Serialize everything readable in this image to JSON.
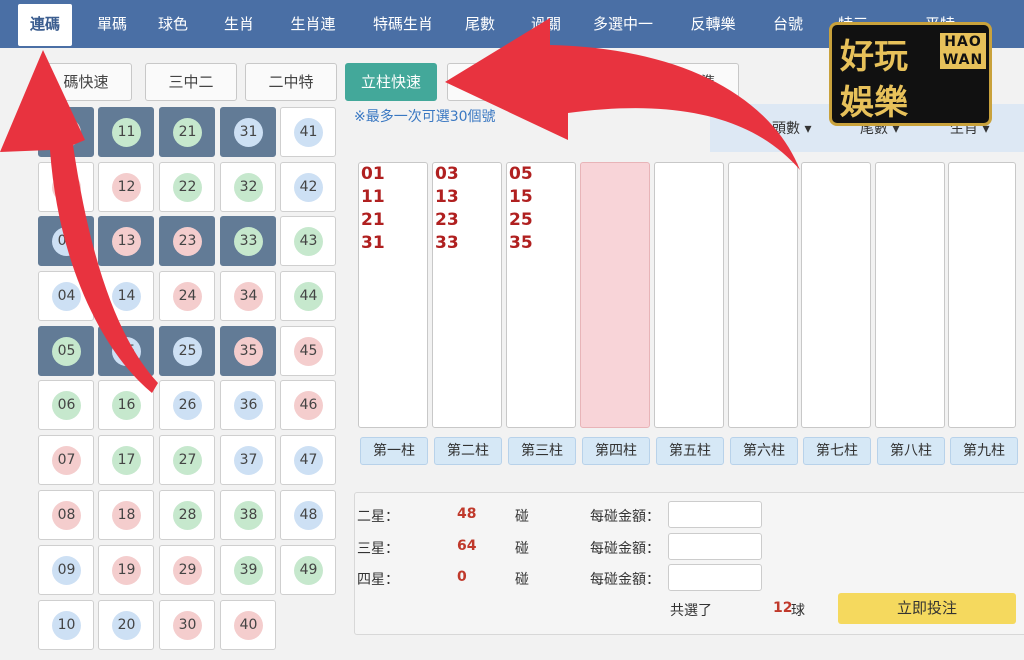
{
  "nav": {
    "items": [
      "連碼",
      "單碼",
      "球色",
      "生肖",
      "生肖連",
      "特碼生肖",
      "尾數",
      "過關",
      "多選中一",
      "反轉樂",
      "台號",
      "特三",
      "平特"
    ],
    "active_index": 0
  },
  "modes": {
    "items": [
      "碼快速",
      "三中二",
      "二中特",
      "立柱快速",
      "",
      "碰標準"
    ],
    "active_index": 3
  },
  "grid": {
    "rows": [
      [
        {
          "n": "01",
          "c": "red",
          "sel": true
        },
        {
          "n": "11",
          "c": "green",
          "sel": true
        },
        {
          "n": "21",
          "c": "green",
          "sel": true
        },
        {
          "n": "31",
          "c": "blue",
          "sel": true
        },
        {
          "n": "41",
          "c": "blue",
          "sel": false
        }
      ],
      [
        {
          "n": "02",
          "c": "red",
          "sel": false
        },
        {
          "n": "12",
          "c": "red",
          "sel": false
        },
        {
          "n": "22",
          "c": "green",
          "sel": false
        },
        {
          "n": "32",
          "c": "green",
          "sel": false
        },
        {
          "n": "42",
          "c": "blue",
          "sel": false
        }
      ],
      [
        {
          "n": "03",
          "c": "blue",
          "sel": true
        },
        {
          "n": "13",
          "c": "red",
          "sel": true
        },
        {
          "n": "23",
          "c": "red",
          "sel": true
        },
        {
          "n": "33",
          "c": "green",
          "sel": true
        },
        {
          "n": "43",
          "c": "green",
          "sel": false
        }
      ],
      [
        {
          "n": "04",
          "c": "blue",
          "sel": false
        },
        {
          "n": "14",
          "c": "blue",
          "sel": false
        },
        {
          "n": "24",
          "c": "red",
          "sel": false
        },
        {
          "n": "34",
          "c": "red",
          "sel": false
        },
        {
          "n": "44",
          "c": "green",
          "sel": false
        }
      ],
      [
        {
          "n": "05",
          "c": "green",
          "sel": true
        },
        {
          "n": "15",
          "c": "blue",
          "sel": true
        },
        {
          "n": "25",
          "c": "blue",
          "sel": true
        },
        {
          "n": "35",
          "c": "red",
          "sel": true
        },
        {
          "n": "45",
          "c": "red",
          "sel": false
        }
      ],
      [
        {
          "n": "06",
          "c": "green",
          "sel": false
        },
        {
          "n": "16",
          "c": "green",
          "sel": false
        },
        {
          "n": "26",
          "c": "blue",
          "sel": false
        },
        {
          "n": "36",
          "c": "blue",
          "sel": false
        },
        {
          "n": "46",
          "c": "red",
          "sel": false
        }
      ],
      [
        {
          "n": "07",
          "c": "red",
          "sel": false
        },
        {
          "n": "17",
          "c": "green",
          "sel": false
        },
        {
          "n": "27",
          "c": "green",
          "sel": false
        },
        {
          "n": "37",
          "c": "blue",
          "sel": false
        },
        {
          "n": "47",
          "c": "blue",
          "sel": false
        }
      ],
      [
        {
          "n": "08",
          "c": "red",
          "sel": false
        },
        {
          "n": "18",
          "c": "red",
          "sel": false
        },
        {
          "n": "28",
          "c": "green",
          "sel": false
        },
        {
          "n": "38",
          "c": "green",
          "sel": false
        },
        {
          "n": "48",
          "c": "blue",
          "sel": false
        }
      ],
      [
        {
          "n": "09",
          "c": "blue",
          "sel": false
        },
        {
          "n": "19",
          "c": "red",
          "sel": false
        },
        {
          "n": "29",
          "c": "red",
          "sel": false
        },
        {
          "n": "39",
          "c": "green",
          "sel": false
        },
        {
          "n": "49",
          "c": "green",
          "sel": false
        }
      ],
      [
        {
          "n": "10",
          "c": "blue",
          "sel": false
        },
        {
          "n": "20",
          "c": "blue",
          "sel": false
        },
        {
          "n": "30",
          "c": "red",
          "sel": false
        },
        {
          "n": "40",
          "c": "red",
          "sel": false
        }
      ]
    ]
  },
  "note": "※最多一次可選30個號",
  "filters": [
    "頭數",
    "尾數",
    "生肖"
  ],
  "columns": {
    "items": [
      {
        "label": "第一柱",
        "nums": [
          "01",
          "11",
          "21",
          "31"
        ]
      },
      {
        "label": "第二柱",
        "nums": [
          "03",
          "13",
          "23",
          "33"
        ]
      },
      {
        "label": "第三柱",
        "nums": [
          "05",
          "15",
          "25",
          "35"
        ]
      },
      {
        "label": "第四柱",
        "nums": [],
        "active": true
      },
      {
        "label": "第五柱",
        "nums": []
      },
      {
        "label": "第六柱",
        "nums": []
      },
      {
        "label": "第七柱",
        "nums": []
      },
      {
        "label": "第八柱",
        "nums": []
      },
      {
        "label": "第九柱",
        "nums": []
      }
    ]
  },
  "summary": {
    "rows": [
      {
        "label": "二星：",
        "count": "48",
        "unit": "碰",
        "amount_label": "每碰金額："
      },
      {
        "label": "三星：",
        "count": "64",
        "unit": "碰",
        "amount_label": "每碰金額："
      },
      {
        "label": "四星：",
        "count": "0",
        "unit": "碰",
        "amount_label": "每碰金額："
      }
    ],
    "total_label": "共選了",
    "total_value": "12",
    "total_unit": "球",
    "submit_label": "立即投注"
  },
  "logo": {
    "line1": "好玩",
    "line2": "娛樂",
    "english": "HAO WAN"
  },
  "colors": {
    "nav": "#4a6fa5",
    "selected_cell": "#627b96",
    "active_mode": "#43a89a",
    "arrow": "#e8333f",
    "submit": "#f5d95e"
  }
}
